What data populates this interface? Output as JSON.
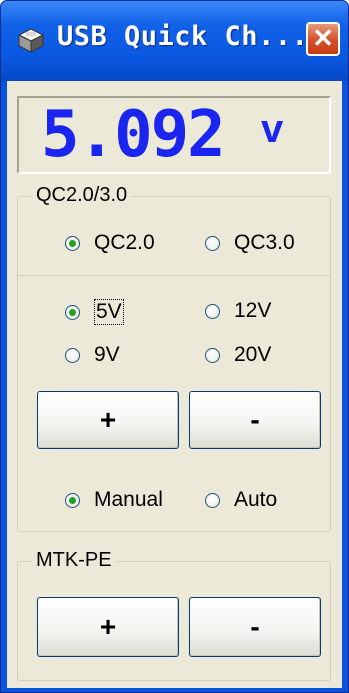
{
  "window": {
    "title": "USB Quick Ch...",
    "close_glyph": "✕"
  },
  "display": {
    "value": "5.092",
    "unit": "v",
    "color": "#1a26f0"
  },
  "qc_group": {
    "legend": "QC2.0/3.0",
    "protocols": [
      {
        "label": "QC2.0",
        "checked": true
      },
      {
        "label": "QC3.0",
        "checked": false
      }
    ],
    "voltages": [
      {
        "label": "5V",
        "checked": true
      },
      {
        "label": "12V",
        "checked": false
      },
      {
        "label": "9V",
        "checked": false
      },
      {
        "label": "20V",
        "checked": false
      }
    ],
    "plus_label": "+",
    "minus_label": "-",
    "modes": [
      {
        "label": "Manual",
        "checked": true
      },
      {
        "label": "Auto",
        "checked": false
      }
    ]
  },
  "mtk_group": {
    "legend": "MTK-PE",
    "plus_label": "+",
    "minus_label": "-"
  },
  "icons": {
    "app": "usb-chip-icon",
    "close": "close-icon"
  }
}
